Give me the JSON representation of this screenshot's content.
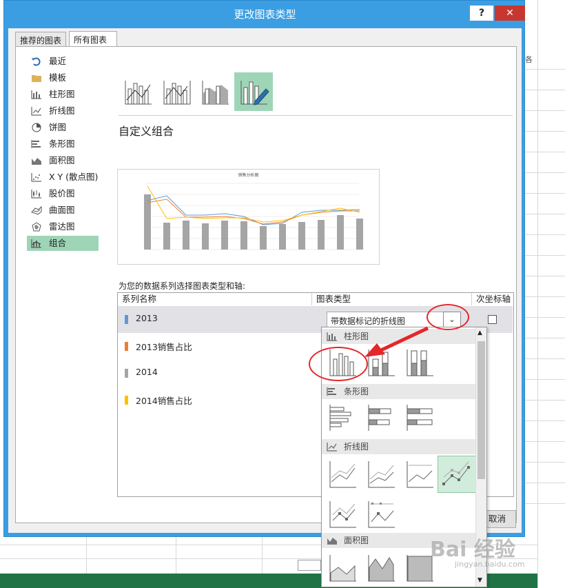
{
  "dialog": {
    "title": "更改图表类型",
    "help_label": "?",
    "close_label": "✕",
    "tabs": [
      {
        "label": "推荐的图表"
      },
      {
        "label": "所有图表"
      }
    ],
    "cancel_label": "取消"
  },
  "sidebar": {
    "items": [
      {
        "label": "最近",
        "icon": "recent-icon"
      },
      {
        "label": "模板",
        "icon": "folder-icon"
      },
      {
        "label": "柱形图",
        "icon": "column-chart-icon"
      },
      {
        "label": "折线图",
        "icon": "line-chart-icon"
      },
      {
        "label": "饼图",
        "icon": "pie-chart-icon"
      },
      {
        "label": "条形图",
        "icon": "bar-chart-icon"
      },
      {
        "label": "面积图",
        "icon": "area-chart-icon"
      },
      {
        "label": "X Y (散点图)",
        "icon": "scatter-chart-icon"
      },
      {
        "label": "股价图",
        "icon": "stock-chart-icon"
      },
      {
        "label": "曲面图",
        "icon": "surface-chart-icon"
      },
      {
        "label": "雷达图",
        "icon": "radar-chart-icon"
      },
      {
        "label": "组合",
        "icon": "combo-chart-icon"
      }
    ],
    "selected_index": 11
  },
  "main": {
    "section_title": "自定义组合",
    "preview_title": "销售分析图",
    "series_prompt": "为您的数据系列选择图表类型和轴:",
    "columns": [
      "系列名称",
      "图表类型",
      "次坐标轴"
    ],
    "series": [
      {
        "name": "2013",
        "color": "#5b9bd5",
        "chart_type": "带数据标记的折线图"
      },
      {
        "name": "2013销售占比",
        "color": "#ed7d31",
        "chart_type": ""
      },
      {
        "name": "2014",
        "color": "#a5a5a5",
        "chart_type": ""
      },
      {
        "name": "2014销售占比",
        "color": "#ffc000",
        "chart_type": ""
      }
    ],
    "dropdown_arrow": "⌄"
  },
  "dropdown": {
    "groups": [
      {
        "label": "柱形图",
        "icon": "column-chart-icon"
      },
      {
        "label": "条形图",
        "icon": "bar-chart-icon"
      },
      {
        "label": "折线图",
        "icon": "line-chart-icon"
      },
      {
        "label": "面积图",
        "icon": "area-chart-icon"
      }
    ],
    "selected_group_index": 2,
    "selected_item_index": 3
  },
  "colors": {
    "accent": "#3c9ee2",
    "selection": "#9fd5b7",
    "annotation": "#e5262a",
    "excel_green": "#217346"
  },
  "watermark": {
    "text": "Bai 经验",
    "url": "jingyan.baidu.com"
  }
}
